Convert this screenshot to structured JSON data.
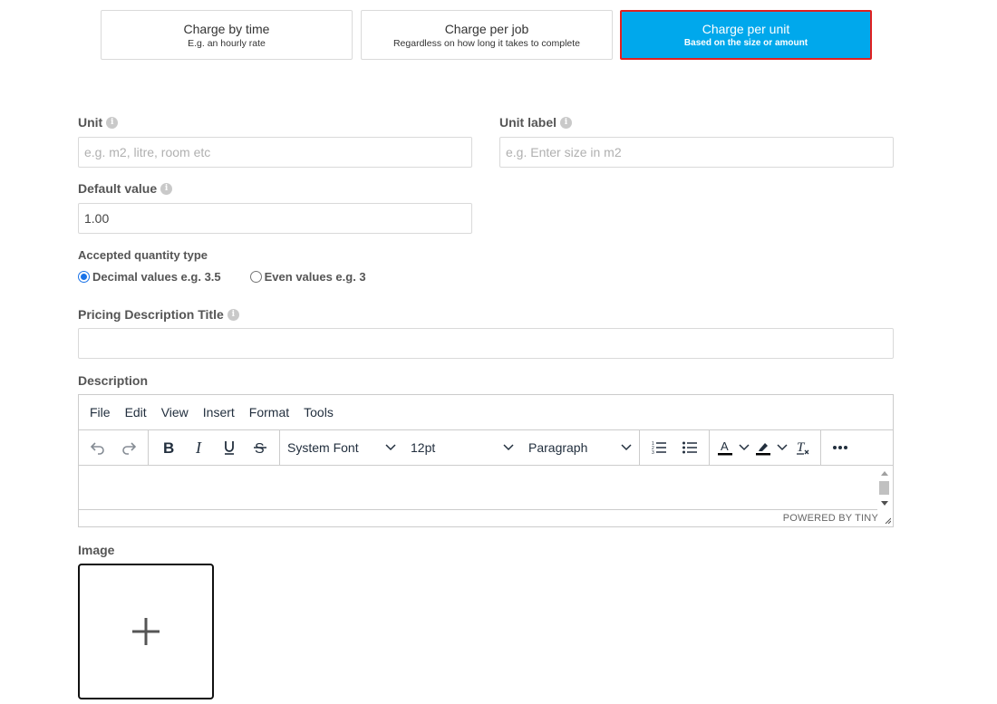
{
  "pricing_modes": [
    {
      "title": "Charge by time",
      "subtitle": "E.g. an hourly rate",
      "active": false
    },
    {
      "title": "Charge per job",
      "subtitle": "Regardless on how long it takes to complete",
      "active": false
    },
    {
      "title": "Charge per unit",
      "subtitle": "Based on the size or amount",
      "active": true
    }
  ],
  "form": {
    "unit": {
      "label": "Unit",
      "placeholder": "e.g. m2, litre, room etc",
      "value": ""
    },
    "unit_label": {
      "label": "Unit label",
      "placeholder": "e.g. Enter size in m2",
      "value": ""
    },
    "default_value": {
      "label": "Default value",
      "value": "1.00"
    },
    "quantity_type": {
      "label": "Accepted quantity type",
      "options": [
        {
          "label": "Decimal values e.g. 3.5",
          "checked": true
        },
        {
          "label": "Even values e.g. 3",
          "checked": false
        }
      ]
    },
    "pricing_description_title": {
      "label": "Pricing Description Title",
      "value": ""
    },
    "description": {
      "label": "Description"
    },
    "image": {
      "label": "Image"
    }
  },
  "editor": {
    "menu": [
      "File",
      "Edit",
      "View",
      "Insert",
      "Format",
      "Tools"
    ],
    "font_family": "System Font",
    "font_size": "12pt",
    "block_format": "Paragraph",
    "status_text": "POWERED BY TINY"
  },
  "icons": {
    "info": "info-icon",
    "undo": "undo-icon",
    "redo": "redo-icon",
    "bold": "bold-icon",
    "italic": "italic-icon",
    "underline": "underline-icon",
    "strikethrough": "strikethrough-icon",
    "numbered_list": "numbered-list-icon",
    "bullet_list": "bullet-list-icon",
    "text_color": "text-color-icon",
    "highlight": "highlight-icon",
    "clear_format": "clear-format-icon",
    "more": "more-icon",
    "add_image": "plus-icon"
  },
  "colors": {
    "active_mode_bg": "#00a8ec",
    "active_mode_border": "#e02020",
    "radio_checked": "#1a73e8"
  }
}
